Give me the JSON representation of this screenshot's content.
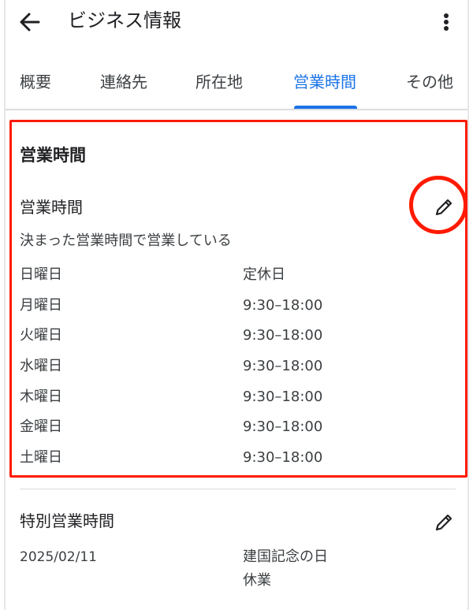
{
  "header": {
    "title": "ビジネス情報"
  },
  "tabs": [
    {
      "label": "概要",
      "active": false
    },
    {
      "label": "連絡先",
      "active": false
    },
    {
      "label": "所在地",
      "active": false
    },
    {
      "label": "営業時間",
      "active": true
    },
    {
      "label": "その他",
      "active": false
    }
  ],
  "hours": {
    "section_title": "営業時間",
    "subsection_title": "営業時間",
    "mode": "決まった営業時間で営業している",
    "rows": [
      {
        "day": "日曜日",
        "time": "定休日"
      },
      {
        "day": "月曜日",
        "time": "9:30–18:00"
      },
      {
        "day": "火曜日",
        "time": "9:30–18:00"
      },
      {
        "day": "水曜日",
        "time": "9:30–18:00"
      },
      {
        "day": "木曜日",
        "time": "9:30–18:00"
      },
      {
        "day": "金曜日",
        "time": "9:30–18:00"
      },
      {
        "day": "土曜日",
        "time": "9:30–18:00"
      }
    ]
  },
  "special_hours": {
    "title": "特別営業時間",
    "date": "2025/02/11",
    "name": "建国記念の日",
    "status": "休業"
  },
  "icons": {
    "back": "arrow-back-icon",
    "more": "more-vert-icon",
    "edit": "pencil-icon"
  },
  "colors": {
    "accent": "#1a73e8",
    "annotation": "#ff1a00",
    "text": "#202124",
    "secondary_text": "#3c4043"
  }
}
